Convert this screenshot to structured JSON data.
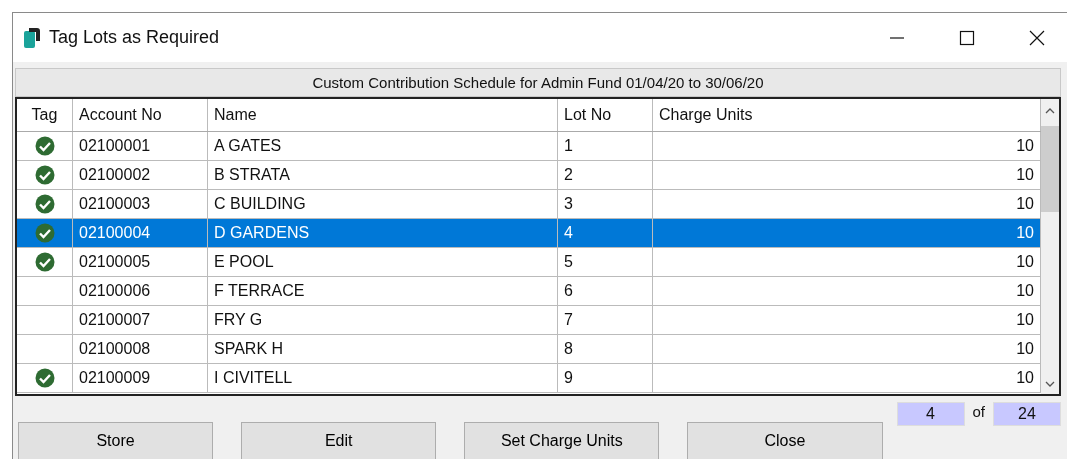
{
  "window": {
    "title": "Tag Lots as Required"
  },
  "schedule_title": "Custom Contribution Schedule for Admin Fund 01/04/20 to 30/06/20",
  "table": {
    "columns": [
      "Tag",
      "Account No",
      "Name",
      "Lot No",
      "Charge Units"
    ],
    "rows": [
      {
        "tagged": true,
        "selected": false,
        "account_no": "02100001",
        "name": "A GATES",
        "lot_no": "1",
        "charge_units": "10"
      },
      {
        "tagged": true,
        "selected": false,
        "account_no": "02100002",
        "name": "B STRATA",
        "lot_no": "2",
        "charge_units": "10"
      },
      {
        "tagged": true,
        "selected": false,
        "account_no": "02100003",
        "name": "C BUILDING",
        "lot_no": "3",
        "charge_units": "10"
      },
      {
        "tagged": true,
        "selected": true,
        "account_no": "02100004",
        "name": "D GARDENS",
        "lot_no": "4",
        "charge_units": "10"
      },
      {
        "tagged": true,
        "selected": false,
        "account_no": "02100005",
        "name": "E POOL",
        "lot_no": "5",
        "charge_units": "10"
      },
      {
        "tagged": false,
        "selected": false,
        "account_no": "02100006",
        "name": "F TERRACE",
        "lot_no": "6",
        "charge_units": "10"
      },
      {
        "tagged": false,
        "selected": false,
        "account_no": "02100007",
        "name": "FRY G",
        "lot_no": "7",
        "charge_units": "10"
      },
      {
        "tagged": false,
        "selected": false,
        "account_no": "02100008",
        "name": "SPARK H",
        "lot_no": "8",
        "charge_units": "10"
      },
      {
        "tagged": true,
        "selected": false,
        "account_no": "02100009",
        "name": "I CIVITELL",
        "lot_no": "9",
        "charge_units": "10"
      }
    ]
  },
  "buttons": [
    "Store",
    "Edit",
    "Set Charge Units",
    "Close"
  ],
  "position": {
    "current": "4",
    "of": "of",
    "total": "24"
  }
}
